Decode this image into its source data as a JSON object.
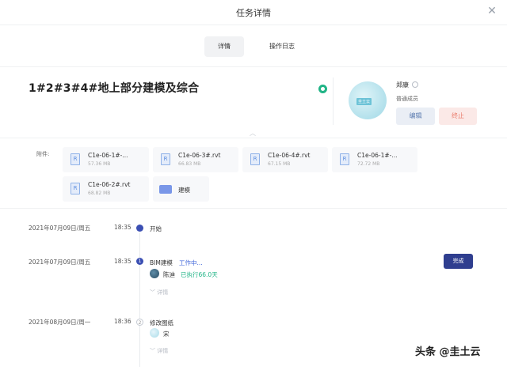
{
  "dialog": {
    "title": "任务详情",
    "close_icon": "close-icon"
  },
  "tabs": [
    {
      "label": "详情",
      "active": true
    },
    {
      "label": "操作日志",
      "active": false
    }
  ],
  "task": {
    "title": "1#2#3#4#地上部分建模及综合",
    "status_color": "#20b486",
    "collapse_icon": "chevron-up-icon"
  },
  "assignee": {
    "avatar_text": "圭土云",
    "name": "郑康",
    "role": "普通成员",
    "edit_label": "编辑",
    "stop_label": "终止"
  },
  "attachments": {
    "label": "附件:",
    "files": [
      {
        "name": "C1e-06-1#-...",
        "size": "57.36 MB",
        "icon": "revit-file-icon",
        "icon_letter": "R"
      },
      {
        "name": "C1e-06-3#.rvt",
        "size": "66.83 MB",
        "icon": "revit-file-icon",
        "icon_letter": "R"
      },
      {
        "name": "C1e-06-4#.rvt",
        "size": "67.15 MB",
        "icon": "revit-file-icon",
        "icon_letter": "R"
      },
      {
        "name": "C1e-06-1#-...",
        "size": "72.72 MB",
        "icon": "revit-file-icon",
        "icon_letter": "R"
      },
      {
        "name": "C1e-06-2#.rvt",
        "size": "68.82 MB",
        "icon": "revit-file-icon",
        "icon_letter": "R"
      },
      {
        "name": "建模",
        "size": "",
        "icon": "folder-icon",
        "icon_letter": ""
      }
    ]
  },
  "timeline": [
    {
      "date": "2021年07月09日/周五",
      "time": "18:35",
      "step": "",
      "label": "开始"
    },
    {
      "date": "2021年07月09日/周五",
      "time": "18:35",
      "step": "1",
      "label": "BIM建模",
      "status": "工作中...",
      "person": "陈迪",
      "elapsed": "已执行66.0天",
      "detail": "详情",
      "done_label": "完成"
    },
    {
      "date": "2021年08月09日/周一",
      "time": "18:36",
      "step": "2",
      "label": "修改图纸",
      "person": "宋",
      "detail": "详情"
    }
  ],
  "watermark": "头条 @圭土云"
}
